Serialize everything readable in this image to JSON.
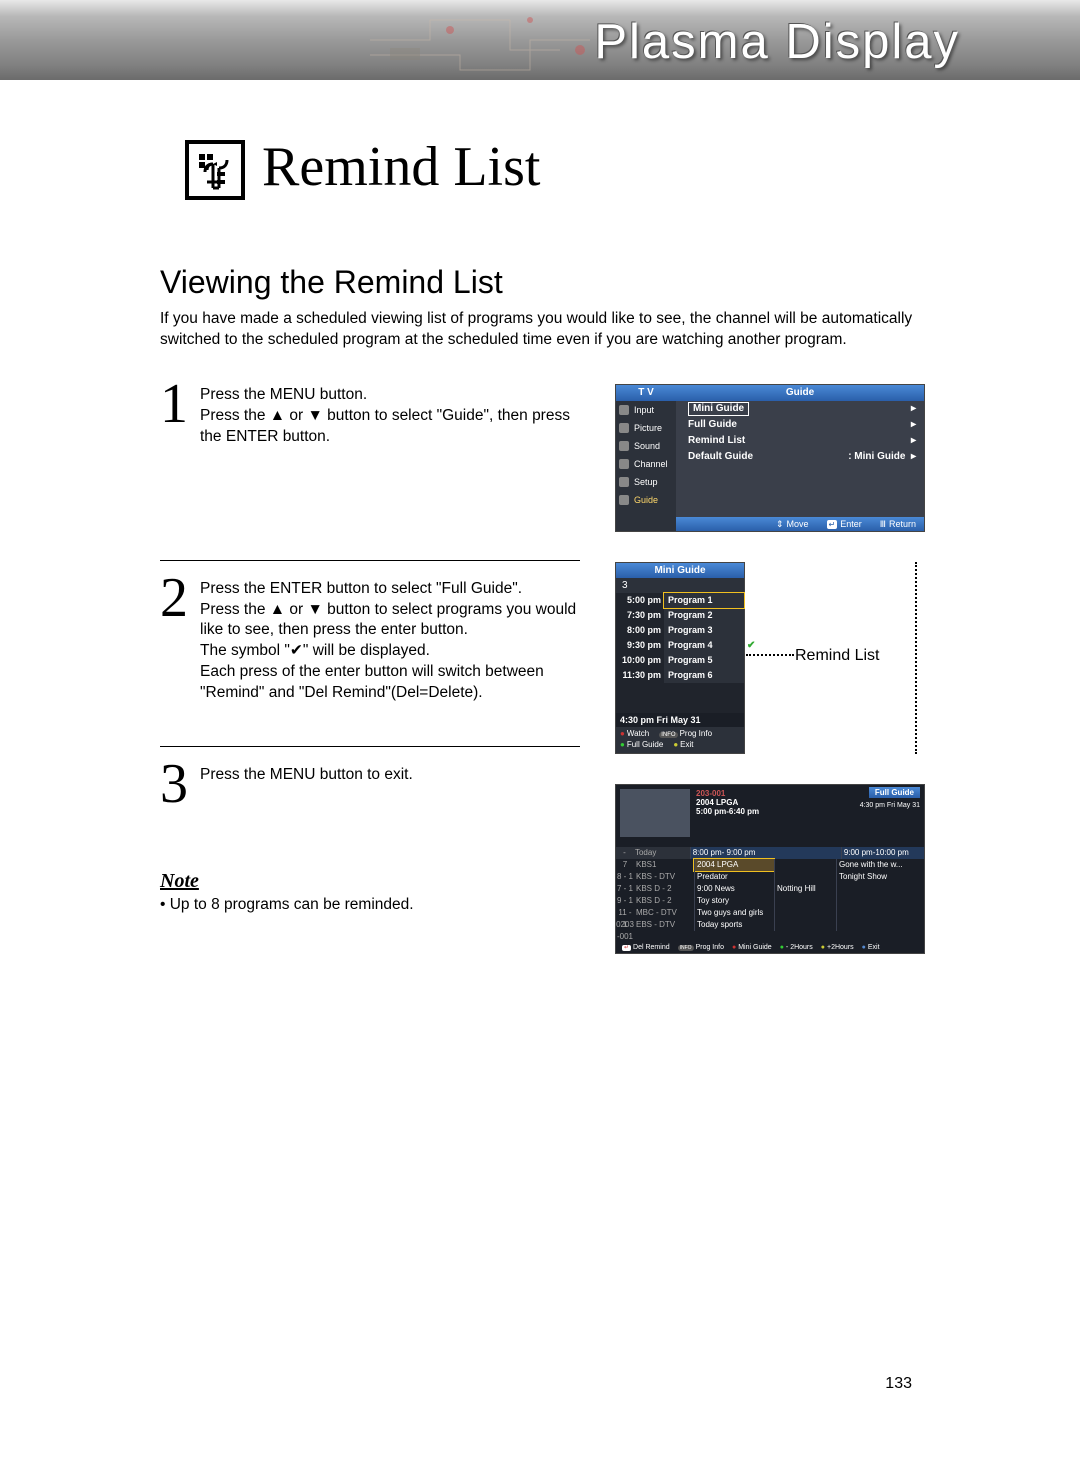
{
  "header": {
    "band_title": "Plasma Display"
  },
  "page": {
    "title": "Remind List",
    "number": "133"
  },
  "section": {
    "title": "Viewing the Remind List",
    "intro": "If you have made a scheduled viewing list of programs you would like to see, the channel will be automatically switched to the scheduled program at the scheduled time even if you are watching another program."
  },
  "steps": [
    {
      "num": "1",
      "text_html": "Press the MENU button.<br>Press the <span class='up'></span> or <span class='dn'></span> button to select \"Guide\", then press the ENTER button."
    },
    {
      "num": "2",
      "text_html": "Press the ENTER button to select \"Full Guide\".<br>Press the <span class='up'></span> or <span class='dn'></span> button to select programs you would like to see, then press the enter button.<br>The symbol \"<span class='chkmark'></span>\" will be displayed.<br>Each press of the enter button will switch between \"Remind\" and \"Del Remind\"(Del=Delete)."
    },
    {
      "num": "3",
      "text_html": "Press the MENU button to exit."
    }
  ],
  "note": {
    "heading": "Note",
    "text": "•  Up to 8 programs can be reminded."
  },
  "fig1": {
    "side_header": "T V",
    "side_items": [
      "Input",
      "Picture",
      "Sound",
      "Channel",
      "Setup",
      "Guide"
    ],
    "main_header": "Guide",
    "options": [
      {
        "label": "Mini Guide",
        "value": "",
        "hl": true
      },
      {
        "label": "Full Guide",
        "value": ""
      },
      {
        "label": "Remind List",
        "value": ""
      },
      {
        "label": "Default Guide",
        "value": ": Mini Guide"
      }
    ],
    "footer": [
      "Move",
      "Enter",
      "Return"
    ]
  },
  "fig2": {
    "header": "Mini Guide",
    "channel": "3",
    "rows": [
      {
        "t": "5:00 pm",
        "p": "Program 1",
        "hl": true
      },
      {
        "t": "7:30 pm",
        "p": "Program 2"
      },
      {
        "t": "8:00 pm",
        "p": "Program 3"
      },
      {
        "t": "9:30 pm",
        "p": "Program 4",
        "chk": true
      },
      {
        "t": "10:00 pm",
        "p": "Program 5"
      },
      {
        "t": "11:30 pm",
        "p": "Program 6"
      }
    ],
    "time": "4:30 pm  Fri May 31",
    "btns": [
      "Watch",
      "Prog Info",
      "Full Guide",
      "Exit"
    ],
    "callout": "Remind List"
  },
  "fig3": {
    "header": "Full Guide",
    "clock": "4:30 pm Fri May 31",
    "info_ch": "203-001",
    "info_title": "2004 LPGA",
    "info_time": "5:00 pm-6:40 pm",
    "thead_c2": "Today",
    "thead_c3": "8:00 pm- 9:00 pm",
    "thead_c5": "9:00 pm-10:00 pm",
    "rows": [
      {
        "n": "7",
        "ch": "KBS1",
        "a": "2004 LPGA",
        "b": "",
        "c": "Gone with the w..."
      },
      {
        "n": "8 - 1",
        "ch": "KBS - DTV",
        "a": "Predator",
        "b": "",
        "c": "Tonight Show"
      },
      {
        "n": "7 - 1",
        "ch": "KBS D - 2",
        "a": "9:00 News",
        "b": "Notting Hill",
        "c": ""
      },
      {
        "n": "9 - 1",
        "ch": "KBS D - 2",
        "a": "Toy story",
        "b": "",
        "c": ""
      },
      {
        "n": "11 - 1",
        "ch": "MBC - DTV",
        "a": "Two guys and girls",
        "b": "",
        "c": ""
      },
      {
        "n": "0203 -001",
        "ch": "EBS - DTV",
        "a": "Today sports",
        "b": "",
        "c": ""
      }
    ],
    "foot": [
      "Del Remind",
      "Prog Info",
      "Mini Guide",
      "- 2Hours",
      "+2Hours",
      "Exit"
    ]
  }
}
